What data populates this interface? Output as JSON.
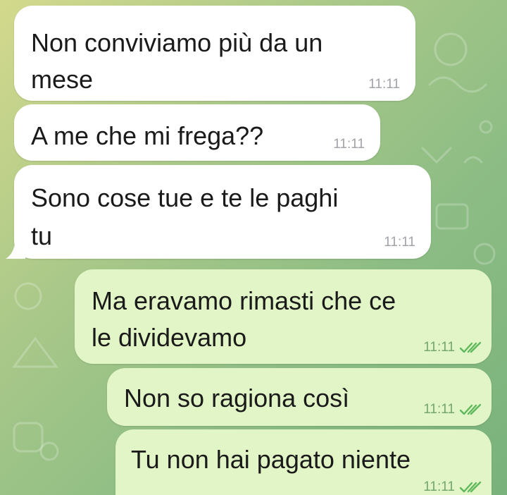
{
  "messages": [
    {
      "direction": "incoming",
      "lines": [
        "Non conviviamo più da un",
        "mese"
      ],
      "time": "11:11"
    },
    {
      "direction": "incoming",
      "lines": [
        "A me che mi frega??"
      ],
      "time": "11:11"
    },
    {
      "direction": "incoming",
      "lines": [
        "Sono cose tue e te le paghi",
        "tu"
      ],
      "time": "11:11"
    },
    {
      "direction": "outgoing",
      "lines": [
        "Ma eravamo rimasti che ce",
        "le dividevamo"
      ],
      "time": "11:11",
      "status": "read-double-check-icon"
    },
    {
      "direction": "outgoing",
      "lines": [
        "Non so ragiona così"
      ],
      "time": "11:11",
      "status": "read-double-check-icon"
    },
    {
      "direction": "outgoing",
      "lines": [
        "Tu non hai pagato niente"
      ],
      "time": "11:11",
      "status": "read-double-check-icon"
    }
  ],
  "colors": {
    "incoming_bubble": "#ffffff",
    "outgoing_bubble": "#e1f5c6",
    "read_check": "#5fb85a",
    "wallpaper_start": "#d3d98c",
    "wallpaper_end": "#79b27c"
  }
}
